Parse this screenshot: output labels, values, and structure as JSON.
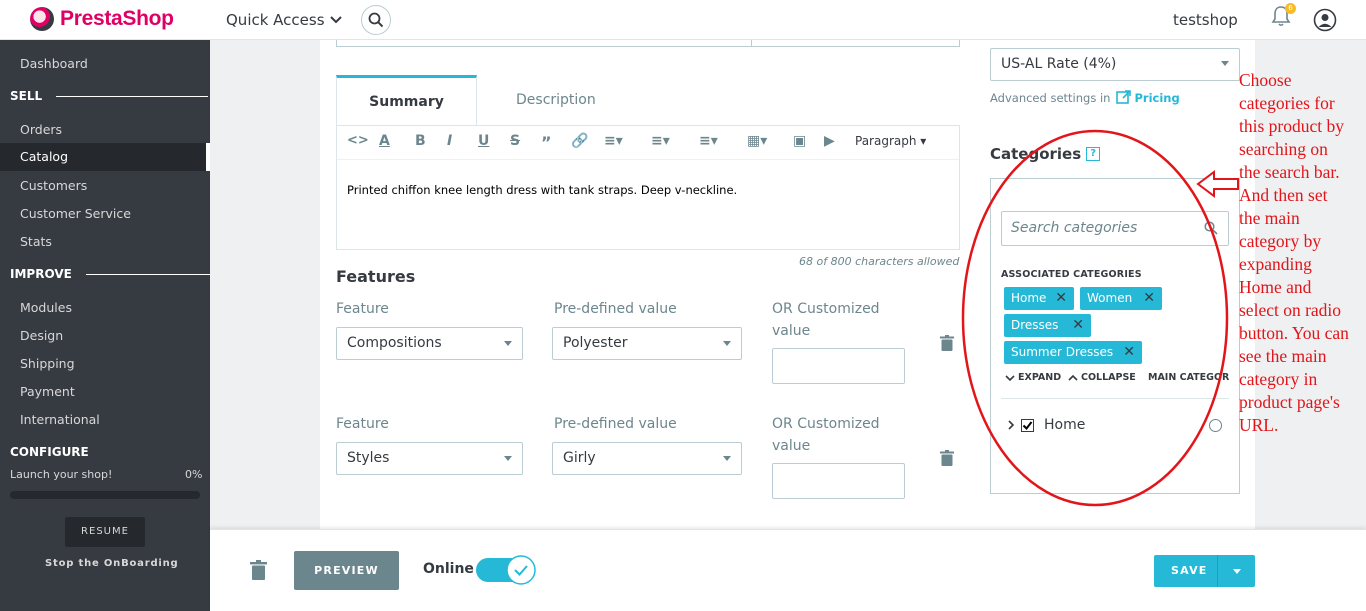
{
  "header": {
    "logo_text": "PrestaShop",
    "quick_access": "Quick Access",
    "shop_name": "testshop",
    "notifications_count": "6"
  },
  "sidebar": {
    "dashboard": "Dashboard",
    "sections": {
      "sell": "SELL",
      "improve": "IMPROVE",
      "configure": "CONFIGURE"
    },
    "sell_items": [
      "Orders",
      "Catalog",
      "Customers",
      "Customer Service",
      "Stats"
    ],
    "improve_items": [
      "Modules",
      "Design",
      "Shipping",
      "Payment",
      "International"
    ],
    "active_item": "Catalog",
    "launch_label": "Launch your shop!",
    "launch_pct": "0%",
    "launch_progress": 0,
    "resume_label": "RESUME",
    "stop_onboarding": "Stop the OnBoarding"
  },
  "tabs": {
    "summary": "Summary",
    "description": "Description"
  },
  "editor": {
    "paragraph_label": "Paragraph",
    "content": "Printed chiffon knee length dress with tank straps. Deep v-neckline.",
    "char_count": "68 of 800 characters allowed"
  },
  "features": {
    "title": "Features",
    "rows": [
      {
        "feature_label": "Feature",
        "feature_value": "Compositions",
        "predef_label": "Pre-defined value",
        "predef_value": "Polyester",
        "custom_label": "OR Customized value"
      },
      {
        "feature_label": "Feature",
        "feature_value": "Styles",
        "predef_label": "Pre-defined value",
        "predef_value": "Girly",
        "custom_label": "OR Customized value"
      }
    ]
  },
  "pricing": {
    "tax_rule": "US-AL Rate (4%)",
    "advanced_settings": "Advanced settings in",
    "pricing_link": "Pricing"
  },
  "categories": {
    "title": "Categories",
    "help": "?",
    "search_placeholder": "Search categories",
    "associated_label": "ASSOCIATED CATEGORIES",
    "tags": [
      "Home",
      "Women",
      "Dresses",
      "Summer Dresses"
    ],
    "expand": "EXPAND",
    "collapse": "COLLAPSE",
    "main_category": "MAIN CATEGORY",
    "tree_root": "Home"
  },
  "annotation": "Choose categories for this product by searching on the search bar. And then set the main category by expanding Home and select on radio button. You can see the main category in product page's URL.",
  "footer": {
    "preview": "PREVIEW",
    "online": "Online",
    "save": "SAVE"
  },
  "colors": {
    "brand": "#df0067",
    "accent": "#25b9d7",
    "sidebar_bg": "#363a41",
    "annotation_red": "#e2151a"
  }
}
